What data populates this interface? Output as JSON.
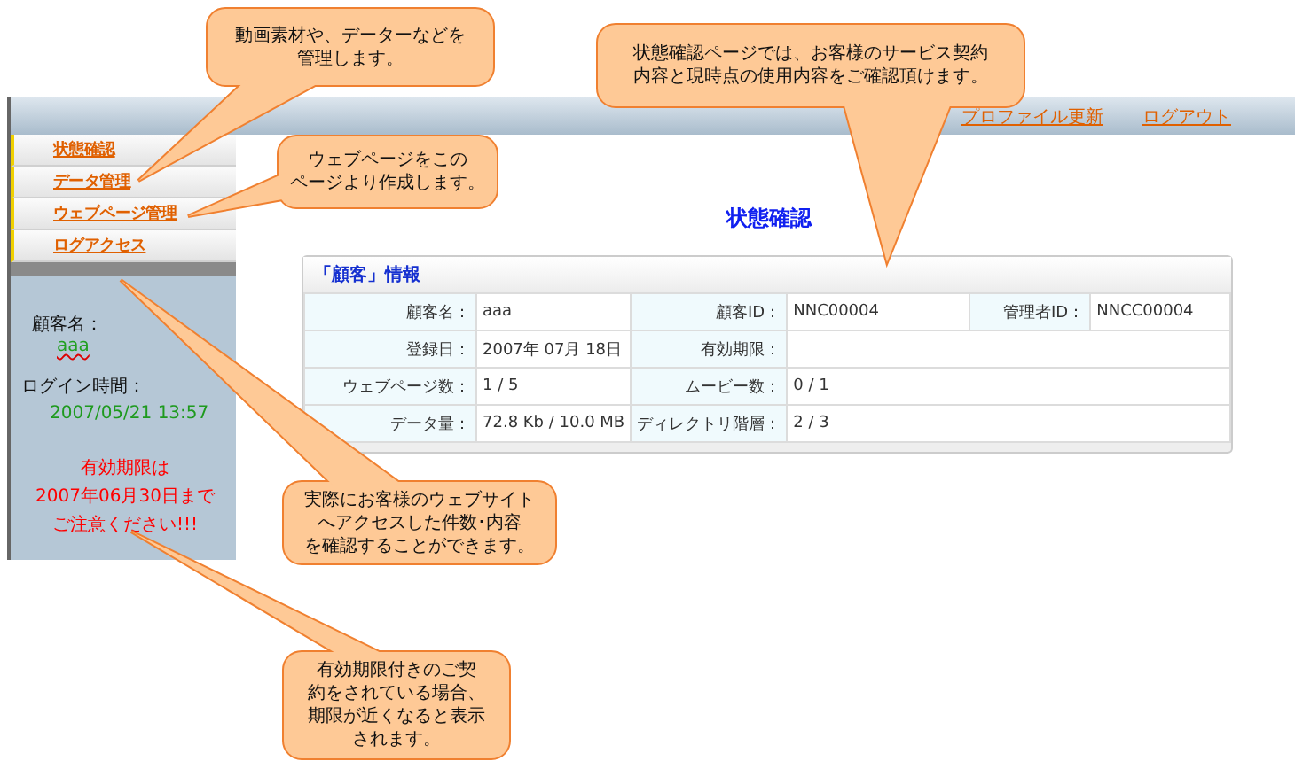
{
  "header": {
    "links": [
      {
        "label": "プロファイル更新"
      },
      {
        "label": "ログアウト"
      }
    ]
  },
  "sidebar": {
    "menu": [
      {
        "label": "状態確認"
      },
      {
        "label": "データ管理"
      },
      {
        "label": "ウェブページ管理"
      },
      {
        "label": "ログアクセス"
      }
    ],
    "customer_label": "顧客名：",
    "customer_name": "aaa",
    "login_label": "ログイン時間：",
    "login_time": "2007/05/21  13:57",
    "notice": [
      "有効期限は",
      "2007年06月30日まで",
      "ご注意ください!!!"
    ]
  },
  "page_title": "状態確認",
  "info_card": {
    "title": "「顧客」情報",
    "rows": [
      [
        {
          "label": "顧客名：",
          "value": "aaa"
        },
        {
          "label": "顧客ID：",
          "value": "NNC00004"
        },
        {
          "label": "管理者ID：",
          "value": "NNCC00004"
        }
      ],
      [
        {
          "label": "登録日：",
          "value": "2007年 07月 18日"
        },
        {
          "label": "有効期限："
        }
      ],
      [
        {
          "label": "ウェブページ数：",
          "value": "1 / 5"
        },
        {
          "label": "ムービー数：",
          "value": "0 / 1"
        }
      ],
      [
        {
          "label": "データ量：",
          "value": "72.8 Kb / 10.0 MB"
        },
        {
          "label": "ディレクトリ階層：",
          "value": "2 / 3"
        }
      ]
    ]
  },
  "callouts": [
    {
      "text": [
        "動画素材や、データーなどを",
        "管理します。"
      ]
    },
    {
      "text": [
        "状態確認ページでは、お客様のサービス契約",
        "内容と現時点の使用内容をご確認頂けます。"
      ]
    },
    {
      "text": [
        "ウェブページをこの",
        "ページより作成します。"
      ]
    },
    {
      "text": [
        "実際にお客様のウェブサイト",
        "へアクセスした件数･内容",
        "を確認することができます。"
      ]
    },
    {
      "text": [
        "有効期限付きのご契",
        "約をされている場合、",
        "期限が近くなると表示",
        "されます。"
      ]
    }
  ]
}
